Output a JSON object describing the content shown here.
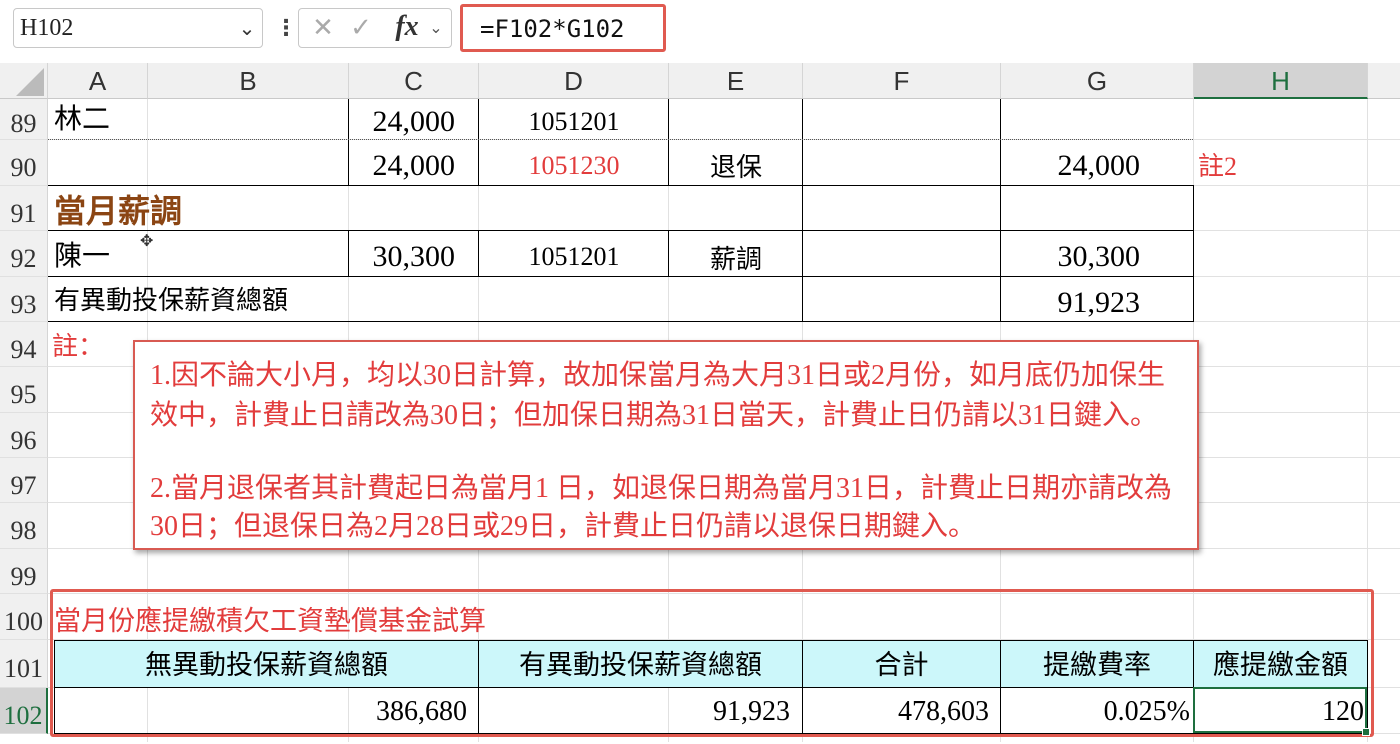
{
  "formula_bar": {
    "name_box": "H102",
    "formula": "=F102*G102",
    "fx_label": "fx",
    "icons": [
      "chevron-down-icon",
      "more-options-icon",
      "cancel-icon",
      "enter-check-icon",
      "function-icon"
    ]
  },
  "columns": [
    "A",
    "B",
    "C",
    "D",
    "E",
    "F",
    "G",
    "H"
  ],
  "selected_column": "H",
  "rows": [
    "89",
    "90",
    "91",
    "92",
    "93",
    "94",
    "95",
    "96",
    "97",
    "98",
    "99",
    "100",
    "101",
    "102"
  ],
  "selected_row": "102",
  "cells": {
    "a89": "林二",
    "c89": "24,000",
    "d89": "1051201",
    "c90": "24,000",
    "d90": "1051230",
    "e90": "退保",
    "g90": "24,000",
    "h90": "註2",
    "a91": "當月薪調",
    "a92": "陳一",
    "c92": "30,300",
    "d92": "1051201",
    "e92": "薪調",
    "g92": "30,300",
    "a93": "有異動投保薪資總額",
    "g93": "91,923",
    "a94": "註：",
    "a100": "當月份應提繳積欠工資墊償基金試算",
    "a101": "無異動投保薪資總額",
    "d101": "有異動投保薪資總額",
    "f101": "合計",
    "g101": "提繳費率",
    "h101": "應提繳金額",
    "a102": "386,680",
    "d102": "91,923",
    "f102": "478,603",
    "g102": "0.025%",
    "h102": "120"
  },
  "note_box": {
    "line1": "1.因不論大小月，均以30日計算，故加保當月為大月31日或2月份，如月底仍加保生",
    "line2": "效中，計費止日請改為30日；但加保日期為31日當天，計費止日仍請以31日鍵入。",
    "line3": "2.當月退保者其計費起日為當月1 日，如退保日期為當月31日，計費止日期亦請改為",
    "line4": "30日；但退保日為2月28日或29日，計費止日仍請以退保日期鍵入。"
  },
  "colors": {
    "note_red": "#e23c3c",
    "header_fill": "#ccf7fa",
    "highlight": "#e05a50",
    "select_green": "#1e6f3f",
    "section_brown": "#8b4513"
  }
}
